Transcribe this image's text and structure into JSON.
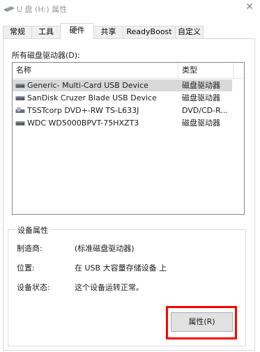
{
  "window": {
    "title": "U 盘 (H:) 属性",
    "icon": "usb-drive-icon",
    "close_glyph": "✕"
  },
  "tabs": [
    {
      "label": "常规"
    },
    {
      "label": "工具"
    },
    {
      "label": "硬件"
    },
    {
      "label": "共享"
    },
    {
      "label": "ReadyBoost"
    },
    {
      "label": "自定义"
    }
  ],
  "active_tab": "硬件",
  "drives_label": "所有磁盘驱动器(D):",
  "device_list": {
    "columns": [
      "名称",
      "类型"
    ],
    "rows": [
      {
        "name": "Generic- Multi-Card USB Device",
        "type": "磁盘驱动器",
        "icon": "disk-drive-icon",
        "selected": true
      },
      {
        "name": "SanDisk Cruzer Blade USB Device",
        "type": "磁盘驱动器",
        "icon": "disk-drive-icon",
        "selected": false
      },
      {
        "name": "TSSTcorp DVD+-RW TS-L633J",
        "type": "DVD/CD-R...",
        "icon": "optical-drive-icon",
        "selected": false
      },
      {
        "name": "WDC WD5000BPVT-75HXZT3",
        "type": "磁盘驱动器",
        "icon": "disk-drive-icon",
        "selected": false
      }
    ]
  },
  "device_properties": {
    "title": "设备属性",
    "manufacturer_label": "制造商:",
    "manufacturer_value": "(标准磁盘驱动器)",
    "location_label": "位置:",
    "location_value": "在 USB 大容量存储设备 上",
    "status_label": "设备状态:",
    "status_value": "这个设备运转正常。"
  },
  "properties_button": "属性(R)",
  "highlight_color": "#ff0000",
  "selection_color": "#d9d9d9"
}
